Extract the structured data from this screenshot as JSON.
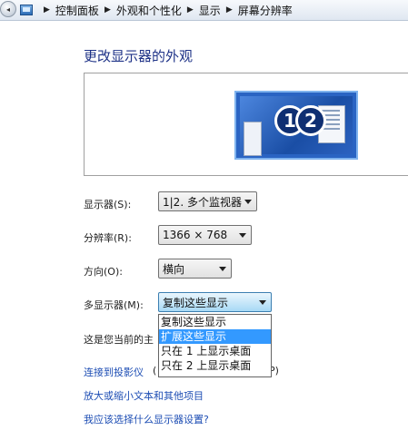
{
  "address_bar": {
    "breadcrumbs": [
      "控制面板",
      "外观和个性化",
      "显示",
      "屏幕分辨率"
    ]
  },
  "page": {
    "title": "更改显示器的外观"
  },
  "preview": {
    "monitor_1": "1",
    "monitor_2": "2"
  },
  "settings": {
    "display_label": "显示器(S):",
    "display_value": "1|2. 多个监视器",
    "resolution_label": "分辨率(R):",
    "resolution_value": "1366 × 768",
    "orientation_label": "方向(O):",
    "orientation_value": "横向",
    "multi_display_label": "多显示器(M):",
    "multi_display_value": "复制这些显示"
  },
  "multi_display_options": [
    "复制这些显示",
    "扩展这些显示",
    "只在 1 上显示桌面",
    "只在 2 上显示桌面"
  ],
  "selected_option_index": 1,
  "status_text": "这是您当前的主",
  "links": {
    "projector": "连接到投影仪",
    "projector_tail_left": "(",
    "projector_tail_right": "P)",
    "text_size": "放大或缩小文本和其他项目",
    "which_settings": "我应该选择什么显示器设置?"
  },
  "colors": {
    "title": "#1e3287",
    "link": "#1e4eb4",
    "selection": "#3399ff",
    "monitor": "#2a64c3"
  }
}
